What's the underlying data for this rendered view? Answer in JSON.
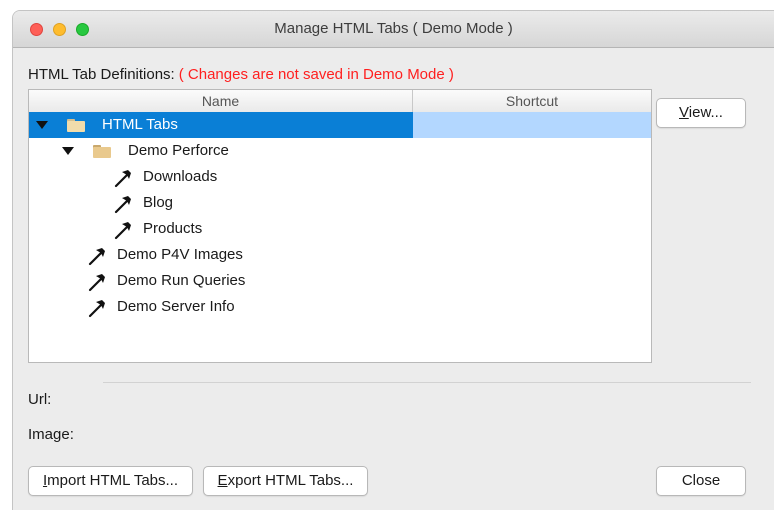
{
  "window": {
    "title": "Manage HTML Tabs ( Demo Mode )"
  },
  "section": {
    "label": "HTML Tab Definitions:",
    "warning": "( Changes are not saved in Demo Mode )",
    "warning_color": "#ff1f1f"
  },
  "tree": {
    "columns": {
      "name": "Name",
      "shortcut": "Shortcut"
    },
    "rows": [
      {
        "label": "HTML Tabs",
        "kind": "folder",
        "expanded": true,
        "selected": true,
        "shortcut": ""
      },
      {
        "label": "Demo Perforce",
        "kind": "folder",
        "expanded": true,
        "selected": false,
        "shortcut": ""
      },
      {
        "label": "Downloads",
        "kind": "hammer-icon",
        "selected": false,
        "shortcut": ""
      },
      {
        "label": "Blog",
        "kind": "hammer-icon",
        "selected": false,
        "shortcut": ""
      },
      {
        "label": "Products",
        "kind": "hammer-icon",
        "selected": false,
        "shortcut": ""
      },
      {
        "label": "Demo P4V Images",
        "kind": "hammer-icon",
        "selected": false,
        "shortcut": ""
      },
      {
        "label": "Demo Run Queries",
        "kind": "hammer-icon",
        "selected": false,
        "shortcut": ""
      },
      {
        "label": "Demo Server Info",
        "kind": "hammer-icon",
        "selected": false,
        "shortcut": ""
      }
    ],
    "selection_color": "#0a7fd6"
  },
  "buttons": {
    "view": {
      "mnemonic": "V",
      "rest": "iew..."
    },
    "import": {
      "mnemonic": "I",
      "rest": "mport HTML Tabs..."
    },
    "export": {
      "mnemonic": "E",
      "rest": "xport HTML Tabs..."
    },
    "close": "Close"
  },
  "fields": {
    "url_label": "Url:",
    "image_label": "Image:"
  }
}
